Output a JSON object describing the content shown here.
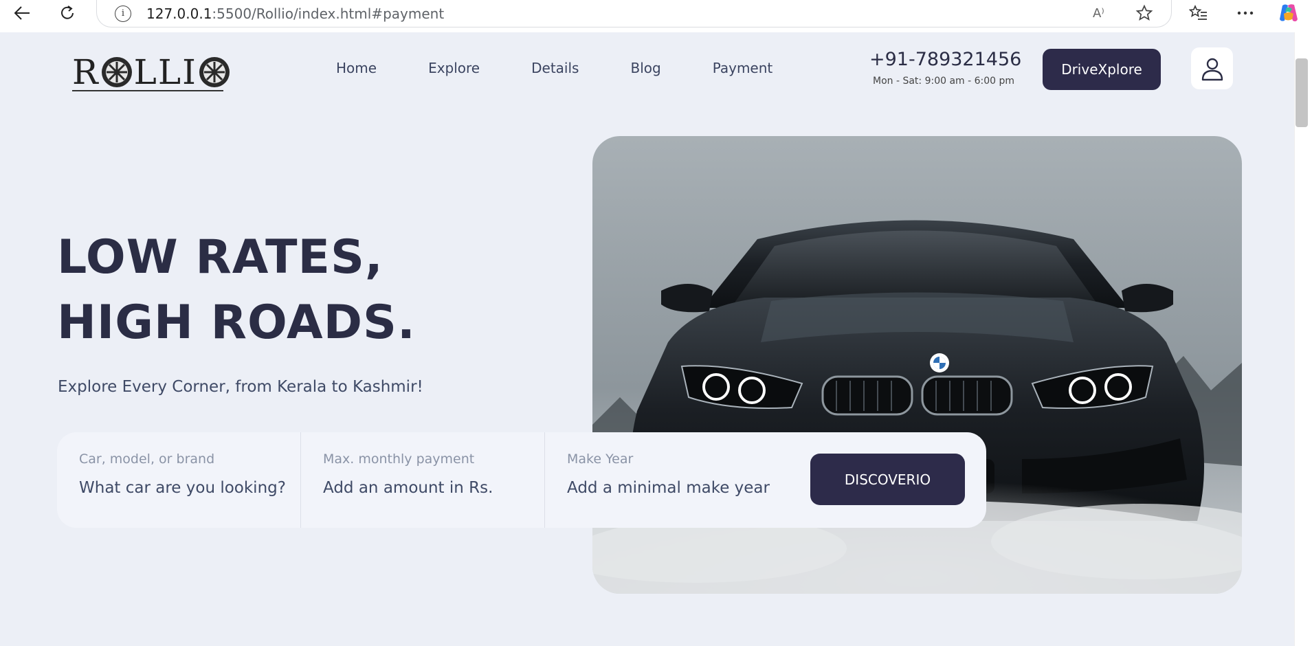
{
  "browser": {
    "url_host": "127.0.0.1",
    "url_rest": ":5500/Rollio/index.html#payment",
    "read_aloud_glyph": "A⁾"
  },
  "header": {
    "logo_text": [
      "R",
      "LLI"
    ],
    "nav": [
      "Home",
      "Explore",
      "Details",
      "Blog",
      "Payment"
    ],
    "phone": "+91-789321456",
    "hours": "Mon - Sat: 9:00 am - 6:00 pm",
    "cta_label": "DriveXplore"
  },
  "hero": {
    "title": "LOW RATES, HIGH ROADS.",
    "subtitle": "Explore Every Corner, from Kerala to Kashmir!"
  },
  "search": {
    "fields": [
      {
        "label": "Car, model, or brand",
        "placeholder": "What car are you looking?"
      },
      {
        "label": "Max. monthly payment",
        "placeholder": "Add an amount in Rs."
      },
      {
        "label": "Make Year",
        "placeholder": "Add a minimal make year"
      }
    ],
    "button_label": "DISCOVERIO"
  },
  "colors": {
    "page_bg": "#eceff6",
    "primary": "#2d2b4a",
    "heading": "#2b2d45"
  }
}
